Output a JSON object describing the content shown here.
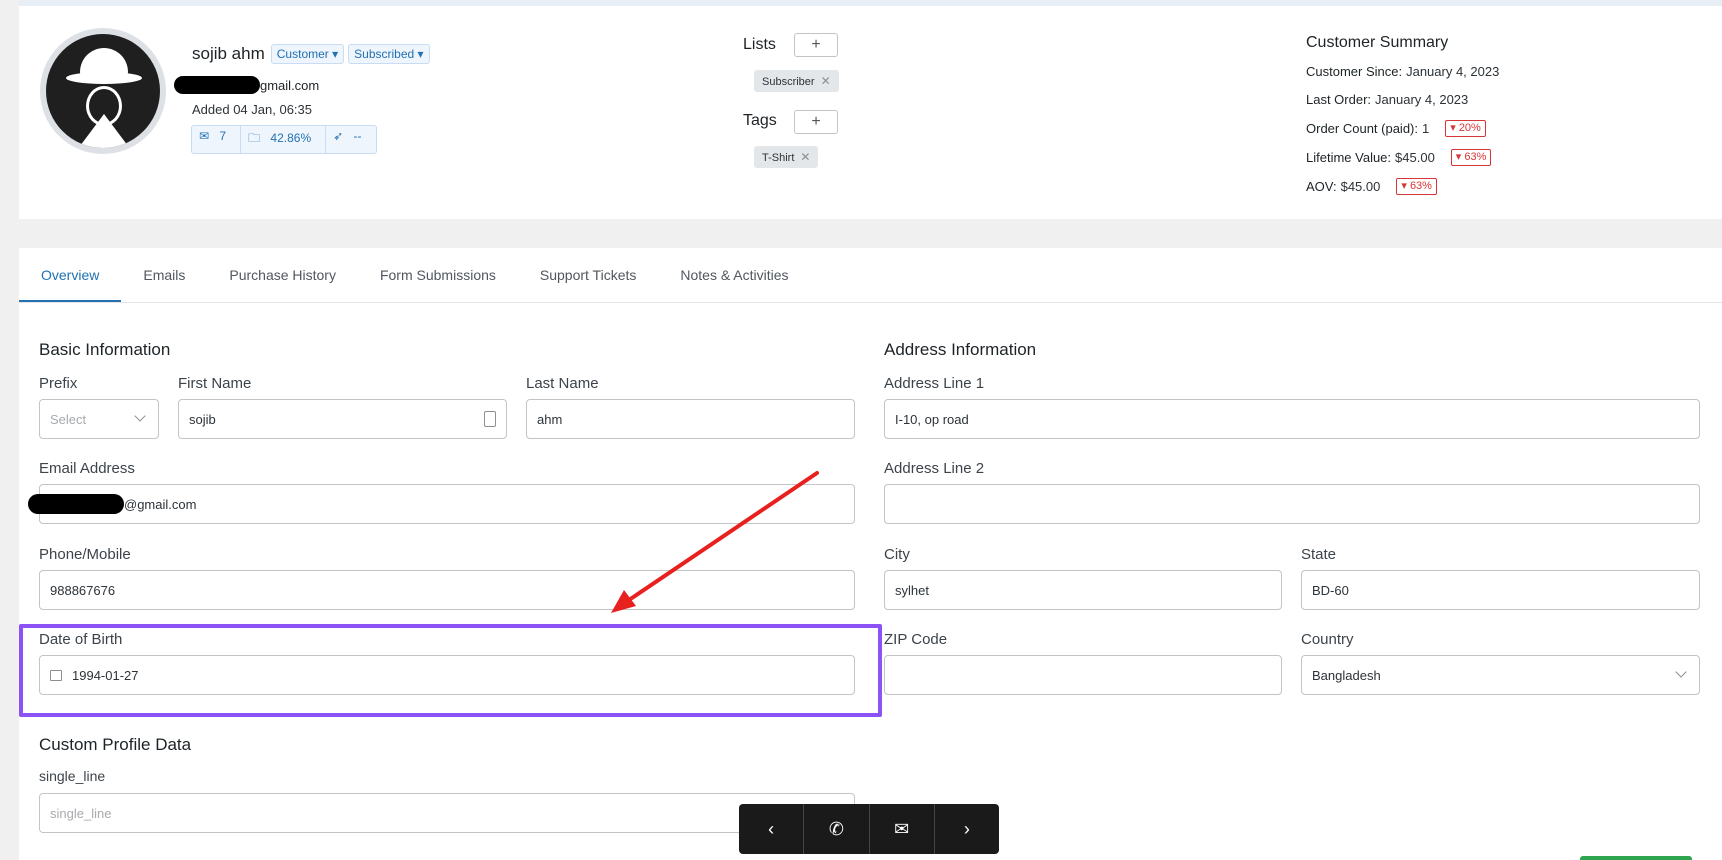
{
  "header": {
    "name": "sojib ahm",
    "badges": [
      "Customer",
      "Subscribed"
    ],
    "email_suffix": "gmail.com",
    "added": "Added 04 Jan, 06:35",
    "stats": {
      "emails": "7",
      "open_rate": "42.86%",
      "click_rate": "--"
    }
  },
  "lists": {
    "label": "Lists",
    "items": [
      "Subscriber"
    ]
  },
  "tags": {
    "label": "Tags",
    "items": [
      "T-Shirt"
    ]
  },
  "summary": {
    "title": "Customer Summary",
    "rows": [
      {
        "label": "Customer Since:",
        "value": "January 4, 2023",
        "trend": ""
      },
      {
        "label": "Last Order:",
        "value": "January 4, 2023",
        "trend": ""
      },
      {
        "label": "Order Count (paid):",
        "value": "1",
        "trend": "20%"
      },
      {
        "label": "Lifetime Value:",
        "value": "$45.00",
        "trend": "63%"
      },
      {
        "label": "AOV:",
        "value": "$45.00",
        "trend": "63%"
      }
    ]
  },
  "tabs": [
    "Overview",
    "Emails",
    "Purchase History",
    "Form Submissions",
    "Support Tickets",
    "Notes & Activities"
  ],
  "basic": {
    "title": "Basic Information",
    "prefix_label": "Prefix",
    "prefix_placeholder": "Select",
    "first_label": "First Name",
    "first_value": "sojib",
    "last_label": "Last Name",
    "last_value": "ahm",
    "email_label": "Email Address",
    "email_suffix": "@gmail.com",
    "phone_label": "Phone/Mobile",
    "phone_value": "988867676",
    "dob_label": "Date of Birth",
    "dob_value": "1994-01-27"
  },
  "address": {
    "title": "Address Information",
    "line1_label": "Address Line 1",
    "line1_value": "I-10, op road",
    "line2_label": "Address Line 2",
    "line2_value": "",
    "city_label": "City",
    "city_value": "sylhet",
    "state_label": "State",
    "state_value": "BD-60",
    "zip_label": "ZIP Code",
    "zip_value": "",
    "country_label": "Country",
    "country_value": "Bangladesh"
  },
  "custom": {
    "title": "Custom Profile Data",
    "single_label": "single_line",
    "single_placeholder": "single_line"
  },
  "colors": {
    "accent": "#2271b1",
    "highlight": "#8c52f5",
    "arrow": "#e8201e",
    "trend_down": "#d63638"
  }
}
